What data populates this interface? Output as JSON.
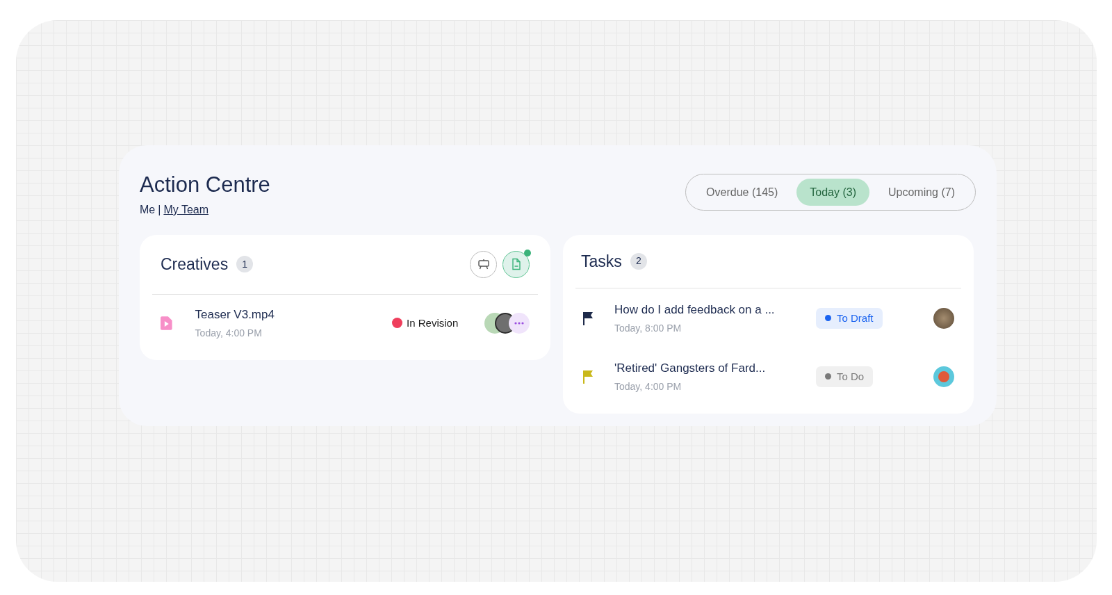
{
  "header": {
    "title": "Action Centre",
    "scope_current": "Me",
    "scope_separator": "|",
    "scope_link": "My Team"
  },
  "tabs": [
    {
      "label": "Overdue (145)",
      "selected": false
    },
    {
      "label": "Today (3)",
      "selected": true
    },
    {
      "label": "Upcoming (7)",
      "selected": false
    }
  ],
  "creatives": {
    "title": "Creatives",
    "count": "1",
    "view_buttons": [
      {
        "kind": "screen",
        "selected": false,
        "notification": false
      },
      {
        "kind": "document",
        "selected": true,
        "notification": true
      }
    ],
    "items": [
      {
        "name": "Teaser V3.mp4",
        "time": "Today, 4:00 PM",
        "status": "In Revision",
        "color": "#ef3e5c"
      }
    ]
  },
  "tasks": {
    "title": "Tasks",
    "count": "2",
    "items": [
      {
        "title": "How do I add feedback on a ...",
        "time": "Today, 8:00 PM",
        "kind": "high_priority",
        "status": "To Draft",
        "color": "#1a63f0"
      },
      {
        "title": "'Retired' Gangsters of Fard...",
        "time": "Today, 4:00 PM",
        "kind": "medium_priority",
        "status": "To Do",
        "color": "#7a7a7a"
      }
    ]
  }
}
